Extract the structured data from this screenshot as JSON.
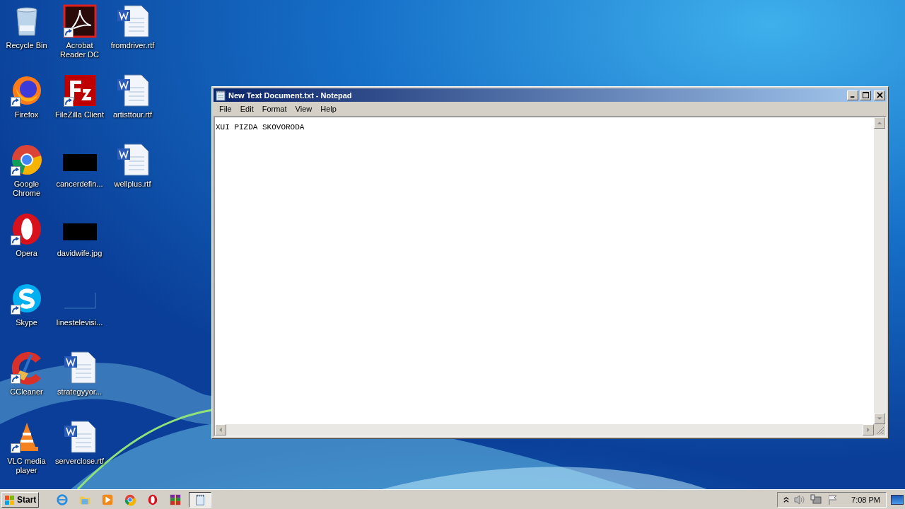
{
  "desktop_icons": [
    {
      "label": "Recycle Bin",
      "kind": "recycle",
      "shortcut": false
    },
    {
      "label": "Firefox",
      "kind": "firefox",
      "shortcut": true
    },
    {
      "label": "Google Chrome",
      "kind": "chrome",
      "shortcut": true
    },
    {
      "label": "Opera",
      "kind": "opera",
      "shortcut": true
    },
    {
      "label": "Skype",
      "kind": "skype",
      "shortcut": true
    },
    {
      "label": "CCleaner",
      "kind": "ccleaner",
      "shortcut": true
    },
    {
      "label": "VLC media player",
      "kind": "vlc",
      "shortcut": true
    },
    {
      "label": "Acrobat Reader DC",
      "kind": "acrobat",
      "shortcut": true
    },
    {
      "label": "FileZilla Client",
      "kind": "filezilla",
      "shortcut": true
    },
    {
      "label": "cancerdefin...",
      "kind": "thumbnail",
      "shortcut": false
    },
    {
      "label": "davidwife.jpg",
      "kind": "thumbnail",
      "shortcut": false
    },
    {
      "label": "linestelevisi...",
      "kind": "blank",
      "shortcut": false
    },
    {
      "label": "strategyyor...",
      "kind": "word",
      "shortcut": false
    },
    {
      "label": "serverclose.rtf",
      "kind": "word",
      "shortcut": false
    },
    {
      "label": "fromdriver.rtf",
      "kind": "word",
      "shortcut": false
    },
    {
      "label": "artisttour.rtf",
      "kind": "word",
      "shortcut": false
    },
    {
      "label": "wellplus.rtf",
      "kind": "word",
      "shortcut": false
    }
  ],
  "notepad": {
    "title": "New Text Document.txt - Notepad",
    "menu": [
      "File",
      "Edit",
      "Format",
      "View",
      "Help"
    ],
    "content": "XUI PIZDA SKOVORODA"
  },
  "taskbar": {
    "start": "Start",
    "items": [
      {
        "kind": "ie",
        "selected": false
      },
      {
        "kind": "folder",
        "selected": false
      },
      {
        "kind": "media",
        "selected": false
      },
      {
        "kind": "chrome",
        "selected": false
      },
      {
        "kind": "opera",
        "selected": false
      },
      {
        "kind": "winrar",
        "selected": false
      },
      {
        "kind": "notepad",
        "selected": true
      }
    ],
    "clock": "7:08 PM"
  }
}
